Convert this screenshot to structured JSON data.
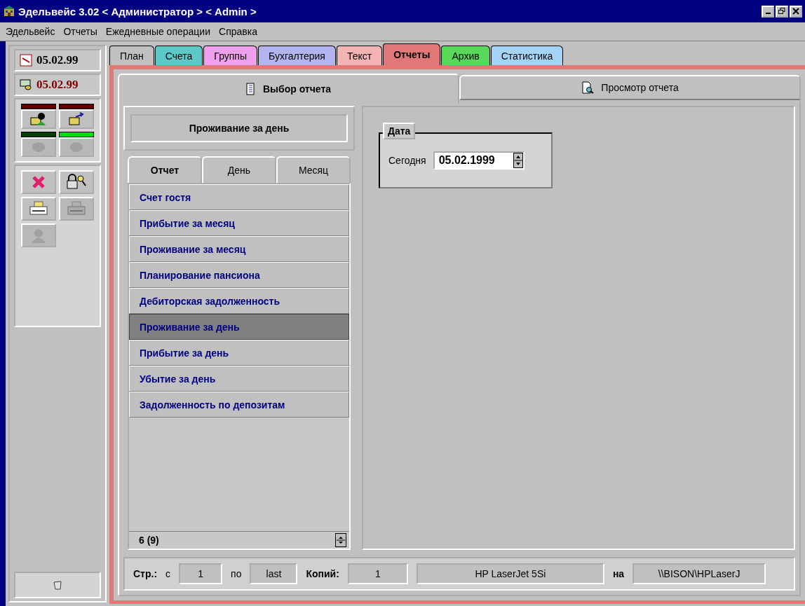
{
  "window": {
    "title": "Эдельвейс 3.02 < Администратор > < Admin >"
  },
  "menu": [
    "Эдельвейс",
    "Отчеты",
    "Ежедневные операции",
    "Справка"
  ],
  "sidebar": {
    "dates": [
      {
        "kind": "calendar",
        "value": "05.02.99",
        "color": "#000000"
      },
      {
        "kind": "money",
        "value": "05.02.99",
        "color": "#800000"
      }
    ],
    "mail_buttons": [
      {
        "kind": "mail-person",
        "color": "#600000",
        "disabled": false
      },
      {
        "kind": "mail-send",
        "color": "#600000",
        "disabled": false
      },
      {
        "kind": "blob",
        "color": "#004000",
        "disabled": true
      },
      {
        "kind": "blob",
        "color": "#00e000",
        "disabled": true
      }
    ],
    "tool_buttons": [
      {
        "kind": "cross",
        "disabled": false
      },
      {
        "kind": "lock-key",
        "disabled": false
      },
      {
        "kind": "printer",
        "disabled": false
      },
      {
        "kind": "printer",
        "disabled": true
      },
      {
        "kind": "person",
        "disabled": true
      }
    ]
  },
  "tabs": [
    {
      "label": "План",
      "color": "#c0c0c0",
      "selected": false
    },
    {
      "label": "Счета",
      "color": "#5cc8c8",
      "selected": false
    },
    {
      "label": "Группы",
      "color": "#f0a0ec",
      "selected": false
    },
    {
      "label": "Бухгалтерия",
      "color": "#b4b4f0",
      "selected": false
    },
    {
      "label": "Текст",
      "color": "#f4b4b4",
      "selected": false
    },
    {
      "label": "Отчеты",
      "color": "#e07878",
      "selected": true
    },
    {
      "label": "Архив",
      "color": "#58d858",
      "selected": false
    },
    {
      "label": "Статистика",
      "color": "#a4d4f8",
      "selected": false
    }
  ],
  "subtabs": [
    {
      "label": "Выбор отчета",
      "kind": "book",
      "selected": true
    },
    {
      "label": "Просмотр отчета",
      "kind": "preview",
      "selected": false
    }
  ],
  "report_title": "Проживание за день",
  "list_tabs": [
    {
      "label": "Отчет",
      "selected": true
    },
    {
      "label": "День",
      "selected": false
    },
    {
      "label": "Месяц",
      "selected": false
    }
  ],
  "reports": [
    {
      "label": "Счет гостя",
      "selected": false
    },
    {
      "label": "Прибытие за месяц",
      "selected": false
    },
    {
      "label": "Проживание за месяц",
      "selected": false
    },
    {
      "label": "Планирование пансиона",
      "selected": false
    },
    {
      "label": "Дебиторская задолженность",
      "selected": false
    },
    {
      "label": "Проживание за день",
      "selected": true
    },
    {
      "label": "Прибытие за день",
      "selected": false
    },
    {
      "label": "Убытие за день",
      "selected": false
    },
    {
      "label": "Задолженность по депозитам",
      "selected": false
    }
  ],
  "list_counter": "6 (9)",
  "date_group": {
    "title": "Дата",
    "label": "Сегодня",
    "value": "05.02.1999"
  },
  "print_bar": {
    "pages_label": "Стр.:",
    "from_label": "с",
    "from": "1",
    "to_label": "по",
    "to": "last",
    "copies_label": "Копий:",
    "copies": "1",
    "printer": "HP LaserJet 5Si",
    "on_label": "на",
    "port": "\\\\BISON\\HPLaserJ"
  }
}
